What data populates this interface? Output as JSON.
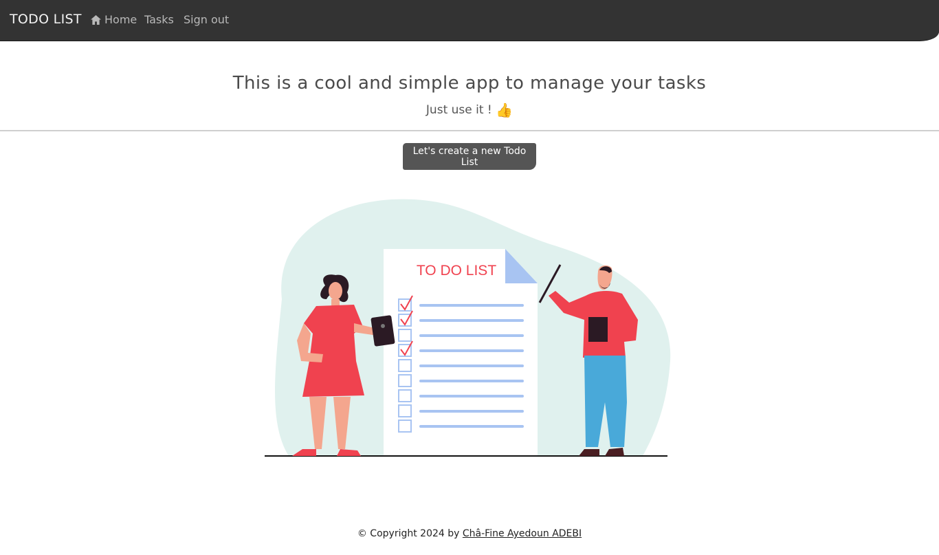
{
  "nav": {
    "brand": "TODO LIST",
    "links": [
      {
        "label": "Home",
        "icon": "home-icon"
      },
      {
        "label": "Tasks"
      },
      {
        "label": "Sign out"
      }
    ]
  },
  "hero": {
    "title": "This is a cool and simple app to manage your tasks",
    "subtitle": "Just use it !",
    "subtitle_emoji": "👍"
  },
  "cta": {
    "label": "Let's create a new Todo List"
  },
  "illustration": {
    "doc_title": "TO DO LIST",
    "checklist": [
      true,
      true,
      false,
      true,
      false,
      false,
      false,
      false,
      false
    ]
  },
  "footer": {
    "prefix": "© Copyright 2024 by ",
    "author": "Châ-Fine Ayedoun ADEBI"
  },
  "colors": {
    "navbar": "#333333",
    "button": "#555555",
    "blob": "#e0f1ee",
    "accent_red": "#f0424f",
    "list_blue": "#a8c4f2"
  }
}
